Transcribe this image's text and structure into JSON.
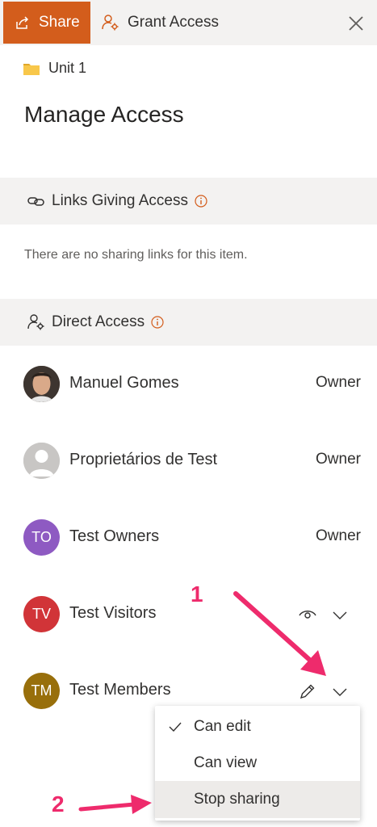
{
  "header": {
    "share_label": "Share",
    "grant_label": "Grant Access"
  },
  "breadcrumb": {
    "folder_name": "Unit 1"
  },
  "title": "Manage Access",
  "links_section": {
    "heading": "Links Giving Access",
    "empty_message": "There are no sharing links for this item."
  },
  "direct_section": {
    "heading": "Direct Access"
  },
  "people": [
    {
      "name": "Manuel Gomes",
      "role": "Owner",
      "avatar": "photo"
    },
    {
      "name": "Proprietários de Test",
      "role": "Owner",
      "avatar": "placeholder"
    },
    {
      "name": "Test Owners",
      "role": "Owner",
      "initials": "TO",
      "color": "#8e5ac2"
    },
    {
      "name": "Test Visitors",
      "role_icon": "eye-icon",
      "initials": "TV",
      "color": "#d13438"
    },
    {
      "name": "Test Members",
      "role_icon": "pencil-icon",
      "initials": "TM",
      "color": "#986f0b"
    }
  ],
  "permission_menu": {
    "items": [
      {
        "label": "Can edit",
        "checked": true
      },
      {
        "label": "Can view",
        "checked": false
      },
      {
        "label": "Stop sharing",
        "checked": false
      }
    ]
  },
  "annotations": {
    "step1": "1",
    "step2": "2"
  },
  "colors": {
    "share_bg": "#d35d1c",
    "annotation": "#ee2b6c",
    "info": "#d35d1c"
  }
}
